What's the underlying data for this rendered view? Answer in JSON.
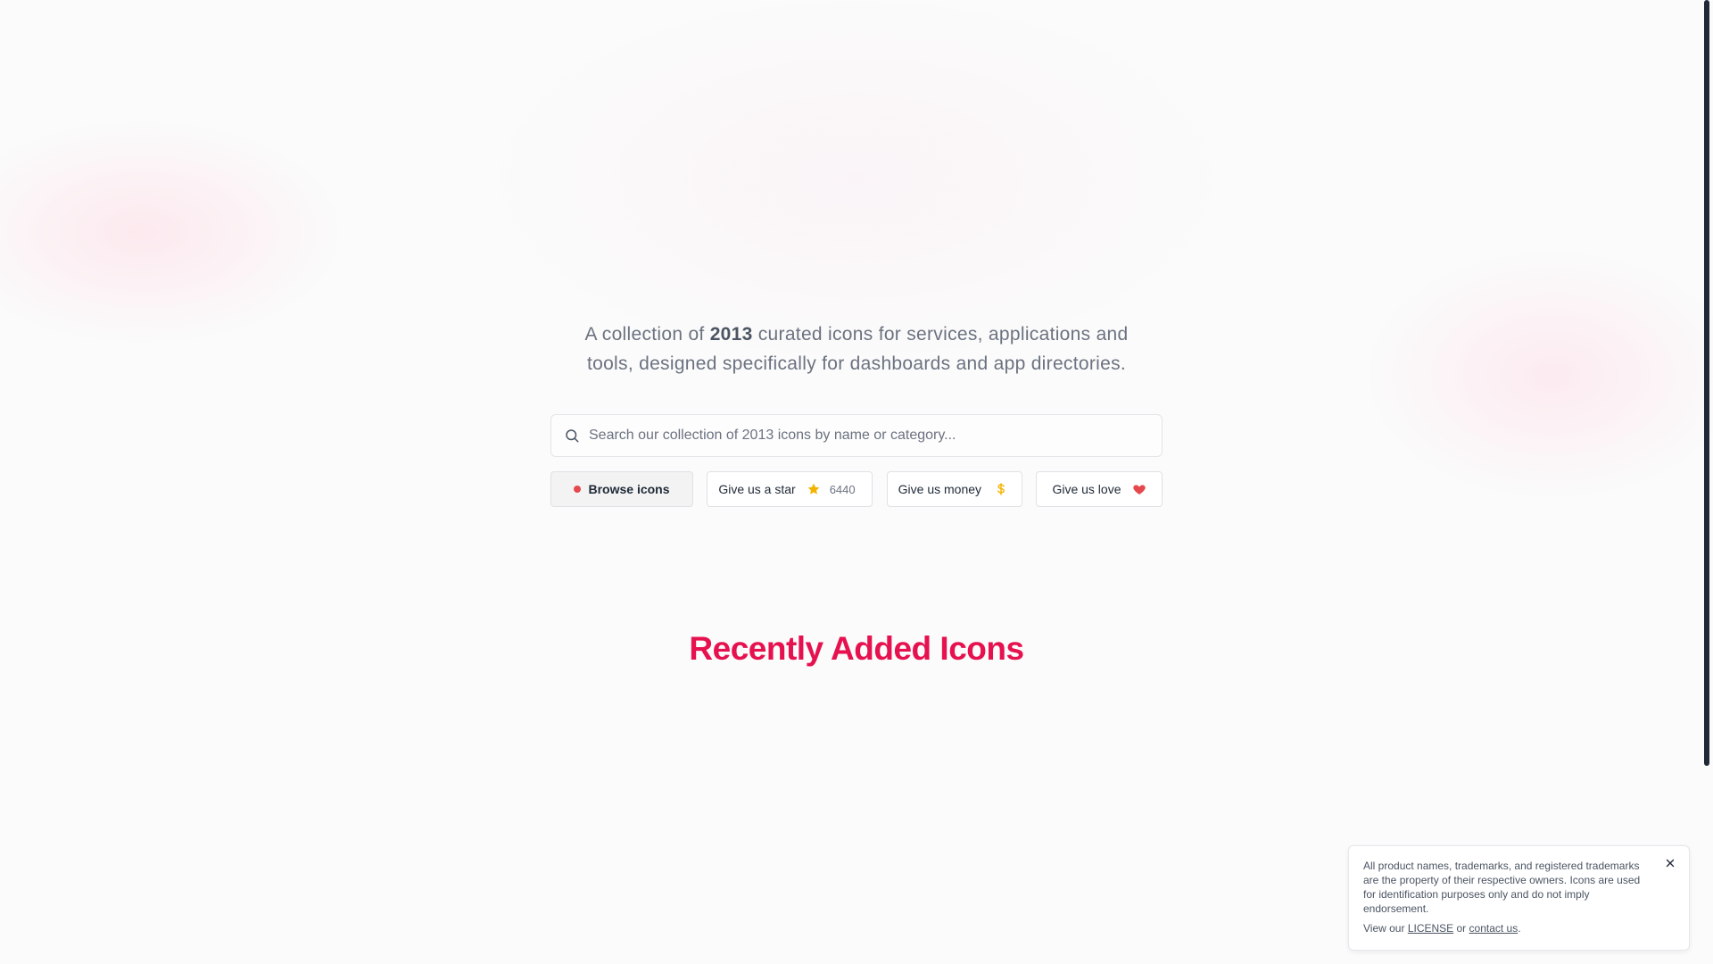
{
  "hero": {
    "tagline_pre": "A collection of ",
    "icon_count": "2013",
    "tagline_post": " curated icons for services, applications and tools, designed specifically for dashboards and app directories."
  },
  "search": {
    "placeholder": "Search our collection of 2013 icons by name or category..."
  },
  "actions": {
    "browse_label": "Browse icons",
    "star_label": "Give us a star",
    "star_count": "6440",
    "money_label": "Give us money",
    "love_label": "Give us love"
  },
  "section": {
    "title": "Recently Added Icons"
  },
  "notice": {
    "text": "All product names, trademarks, and registered trademarks are the property of their respective owners. Icons are used for identification purposes only and do not imply endorsement.",
    "view_prefix": "View our ",
    "license_label": "LICENSE",
    "or_text": " or ",
    "contact_label": "contact us",
    "period": "."
  },
  "colors": {
    "accent": "#e6114f",
    "star": "#f5b301",
    "heart": "#e5484d",
    "dollar": "#f5b301"
  },
  "icons": {
    "search": "search-icon",
    "star": "star-icon",
    "dollar": "dollar-icon",
    "heart": "heart-icon",
    "close": "close-icon"
  }
}
